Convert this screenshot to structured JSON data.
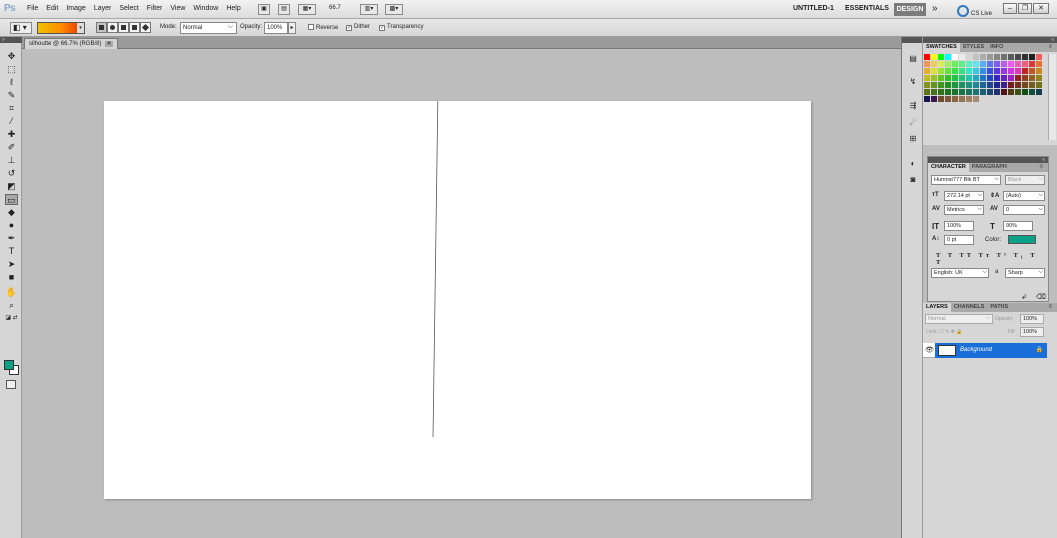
{
  "app": {
    "logo": "Ps"
  },
  "menu": [
    "File",
    "Edit",
    "Image",
    "Layer",
    "Select",
    "Filter",
    "View",
    "Window",
    "Help"
  ],
  "menubar": {
    "zoom": "66.7",
    "workspace_doc": "UNTITLED-1",
    "workspace_essentials": "ESSENTIALS",
    "workspace_design": "DESIGN",
    "more": "»",
    "cslive": "CS Live"
  },
  "options": {
    "mode_label": "Mode:",
    "mode_value": "Normal",
    "opacity_label": "Opacity:",
    "opacity_value": "100%",
    "reverse": "Reverse",
    "dither": "Dither",
    "transparency": "Transparency"
  },
  "document": {
    "tab_title": "silhoutte @ 66.7% (RGB/8)",
    "foreground_color": "#0ba186",
    "background_color": "#ffffff"
  },
  "swatches_panel": {
    "tabs": [
      "SWATCHES",
      "STYLES",
      "INFO"
    ]
  },
  "character_panel": {
    "tabs": [
      "CHARACTER",
      "PARAGRAPH"
    ],
    "font_family": "Humnst777 Blk BT",
    "font_style": "Black",
    "font_size": "272.14 pt",
    "leading": "(Auto)",
    "kerning": "Metrics",
    "tracking": "0",
    "vertical_scale": "100%",
    "horizontal_scale": "90%",
    "baseline_shift": "0 pt",
    "color_label": "Color:",
    "color": "#0ba186",
    "language": "English: UK",
    "antialias_label": "a",
    "antialias": "Sharp"
  },
  "layers_panel": {
    "tabs": [
      "LAYERS",
      "CHANNELS",
      "PATHS"
    ],
    "blend_mode": "Normal",
    "opacity_label": "Opacity:",
    "opacity_value": "100%",
    "lock_label": "Lock:",
    "fill_label": "Fill:",
    "fill_value": "100%",
    "layer_name": "Background"
  }
}
